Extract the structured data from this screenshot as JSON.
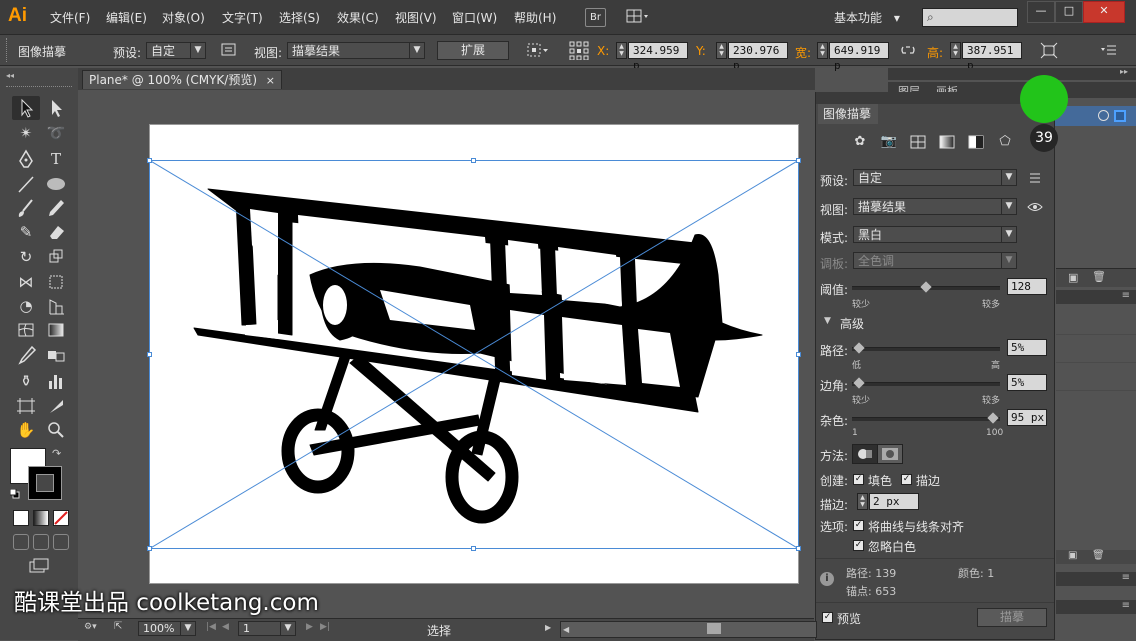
{
  "app": {
    "logo": "Ai"
  },
  "menu": [
    "文件(F)",
    "编辑(E)",
    "对象(O)",
    "文字(T)",
    "选择(S)",
    "效果(C)",
    "视图(V)",
    "窗口(W)",
    "帮助(H)"
  ],
  "menubar": {
    "bridge": "Br",
    "workspace": "基本功能",
    "workspace_arrow": "▾"
  },
  "control": {
    "panel_name": "图像描摹",
    "preset_label": "预设:",
    "preset_value": "自定",
    "view_label": "视图:",
    "view_value": "描摹结果",
    "expand": "扩展",
    "x_label": "X:",
    "x_value": "324.959 p",
    "y_label": "Y:",
    "y_value": "230.976 p",
    "w_label": "宽:",
    "w_value": "649.919 p",
    "h_label": "高:",
    "h_value": "387.951 p"
  },
  "document": {
    "tab_title": "Plane* @ 100% (CMYK/预览)",
    "close": "×"
  },
  "layers": {
    "tab1": "图层",
    "tab2": "画板"
  },
  "trace": {
    "title": "图像描摹",
    "preset_label": "预设:",
    "preset_value": "自定",
    "view_label": "视图:",
    "view_value": "描摹结果",
    "mode_label": "模式:",
    "mode_value": "黑白",
    "palette_label": "调板:",
    "palette_value": "全色调",
    "threshold_label": "阈值:",
    "threshold_value": "128",
    "threshold_pos": 0.5,
    "threshold_min": "较少",
    "threshold_max": "较多",
    "advanced": "高级",
    "paths_label": "路径:",
    "paths_value": "5%",
    "paths_min": "低",
    "paths_max": "高",
    "paths_pos": 0.05,
    "corners_label": "边角:",
    "corners_value": "5%",
    "corners_min": "较少",
    "corners_max": "较多",
    "corners_pos": 0.05,
    "noise_label": "杂色:",
    "noise_value": "95 px",
    "noise_min": "1",
    "noise_max": "100",
    "noise_pos": 0.95,
    "method_label": "方法:",
    "create_label": "创建:",
    "fill_label": "填色",
    "stroke_label": "描边",
    "stroke_w_label": "描边:",
    "stroke_w_value": "2 px",
    "options_label": "选项:",
    "snap_label": "将曲线与线条对齐",
    "ignore_white_label": "忽略白色",
    "paths_count_label": "路径:",
    "paths_count": "139",
    "colors_label": "颜色:",
    "colors_count": "1",
    "anchors_label": "锚点:",
    "anchors_count": "653",
    "preview_label": "预览",
    "trace_button": "描摹"
  },
  "status": {
    "zoom": "100%",
    "page": "1",
    "tool": "选择"
  },
  "overlay": {
    "step": "39",
    "watermark": "酷课堂出品 coolketang.com"
  },
  "colors": {
    "accent": "#ff9a00",
    "selection": "#4a8bd6",
    "cursor": "#22c41a"
  }
}
